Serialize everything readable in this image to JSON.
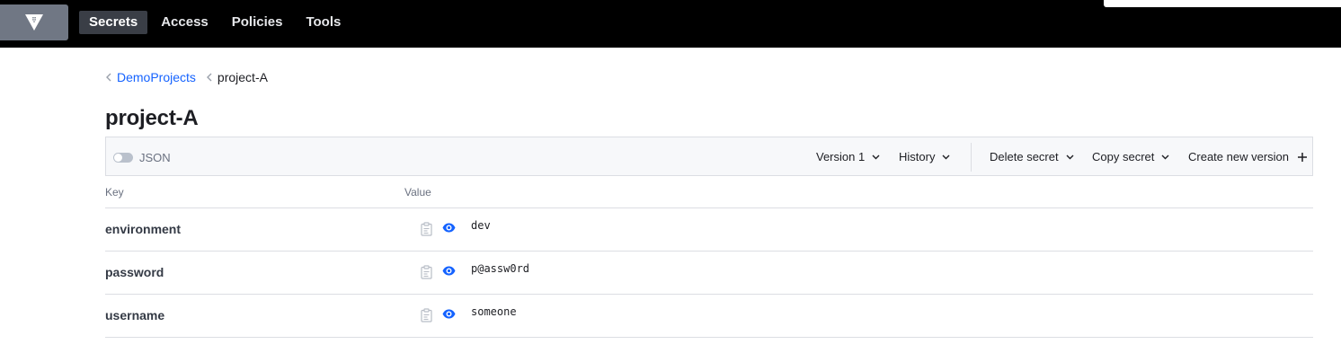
{
  "nav": {
    "logo": "vault-logo-icon",
    "items": [
      {
        "label": "Secrets",
        "active": true
      },
      {
        "label": "Access",
        "active": false
      },
      {
        "label": "Policies",
        "active": false
      },
      {
        "label": "Tools",
        "active": false
      }
    ]
  },
  "breadcrumb": {
    "parent": "DemoProjects",
    "current": "project-A"
  },
  "title": "project-A",
  "toolbar": {
    "json_label": "JSON",
    "json_enabled": false,
    "version_label": "Version 1",
    "history_label": "History",
    "delete_label": "Delete secret",
    "copy_label": "Copy secret",
    "create_label": "Create new version"
  },
  "table": {
    "headers": {
      "key": "Key",
      "value": "Value"
    },
    "rows": [
      {
        "key": "environment",
        "value": "dev"
      },
      {
        "key": "password",
        "value": "p@assw0rd"
      },
      {
        "key": "username",
        "value": "someone"
      }
    ]
  },
  "colors": {
    "topbar": "#000000",
    "link": "#1563ff",
    "eye_icon": "#1563ff",
    "border": "#dcdee3"
  }
}
